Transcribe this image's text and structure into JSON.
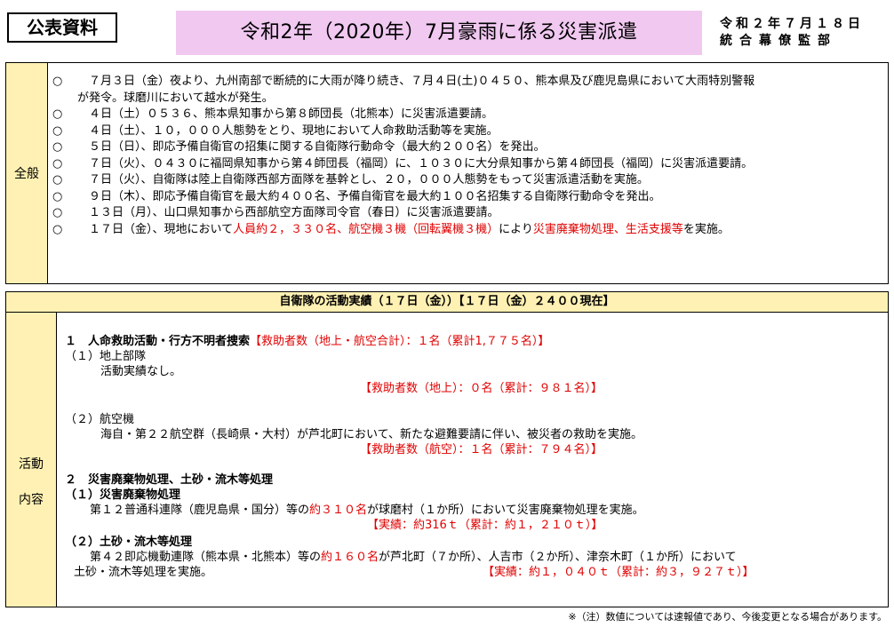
{
  "header": {
    "tag": "公表資料",
    "title": "令和2年（2020年）7月豪雨に係る災害派遣",
    "date": "令和２年７月１８日",
    "org": "統合幕僚監部"
  },
  "general": {
    "label": "全般",
    "bullet": "○",
    "items": [
      {
        "segs": [
          {
            "t": "　７月３日（金）夜より、九州南部で断続的に大雨が降り続き、７月４日(土)０４５０、熊本県及び鹿児島県において大雨特別警報",
            "red": false
          }
        ],
        "cont": "が発令。球磨川において越水が発生。"
      },
      {
        "segs": [
          {
            "t": "　４日（土）０５３６、熊本県知事から第８師団長（北熊本）に災害派遣要請。",
            "red": false
          }
        ]
      },
      {
        "segs": [
          {
            "t": "　４日（土）、１０，０００人態勢をとり、現地において人命救助活動等を実施。",
            "red": false
          }
        ]
      },
      {
        "segs": [
          {
            "t": "　５日（日）、即応予備自衛官の招集に関する自衛隊行動命令（最大約２００名）を発出。",
            "red": false
          }
        ]
      },
      {
        "segs": [
          {
            "t": "　７日（火）、０４３０に福岡県知事から第４師団長（福岡）に、１０３０に大分県知事から第４師団長（福岡）に災害派遣要請。",
            "red": false
          }
        ]
      },
      {
        "segs": [
          {
            "t": "　７日（火）、自衛隊は陸上自衛隊西部方面隊を基幹とし、２０，０００人態勢をもって災害派遣活動を実施。",
            "red": false
          }
        ]
      },
      {
        "segs": [
          {
            "t": "　９日（木）、即応予備自衛官を最大約４００名、予備自衛官を最大約１００名招集する自衛隊行動命令を発出。",
            "red": false
          }
        ]
      },
      {
        "segs": [
          {
            "t": "　１３日（月）、山口県知事から西部航空方面隊司令官（春日）に災害派遣要請。",
            "red": false
          }
        ]
      },
      {
        "segs": [
          {
            "t": "　１７日（金）、現地において",
            "red": false
          },
          {
            "t": "人員約２，３３０名、航空機３機（回転翼機３機）",
            "red": true
          },
          {
            "t": "により",
            "red": false
          },
          {
            "t": "災害廃棄物処理、生活支援等",
            "red": true
          },
          {
            "t": "を実施。",
            "red": false
          }
        ]
      }
    ]
  },
  "activity": {
    "header": "自衛隊の活動実績（１７日（金））【１７日（金）２４００現在】",
    "side_top": "活動",
    "side_bottom": "内容",
    "s1_title": "１　人命救助活動・行方不明者捜索",
    "s1_total": "【救助者数（地上・航空合計）：１名（累計1,７７５名）】",
    "s1_ground_label": "（１）地上部隊",
    "s1_ground_text": "活動実績なし。",
    "s1_ground_count": "【救助者数（地上）：０名（累計：９８１名）】",
    "s1_air_label": "（２）航空機",
    "s1_air_text": "海自・第２２航空群（長崎県・大村）が芦北町において、新たな避難要請に伴い、被災者の救助を実施。",
    "s1_air_count": "【救助者数（航空）：１名（累計：７９４名）】",
    "s2_title": "２　災害廃棄物処理、土砂・流木等処理",
    "s2_1_label": "（１）災害廃棄物処理",
    "s2_1_a": "第１２普通科連隊（鹿児島県・国分）等の",
    "s2_1_red": "約３１０名",
    "s2_1_b": "が球磨村（１か所）において災害廃棄物処理を実施。",
    "s2_1_result": "【実績：約316ｔ（累計：約１，２１０ｔ）】",
    "s2_2_label": "（２）土砂・流木等処理",
    "s2_2_a": "第４２即応機動連隊（熊本県・北熊本）等の",
    "s2_2_red": "約１６０名",
    "s2_2_b": "が芦北町（７か所）、人吉市（２か所）、津奈木町（１か所）において",
    "s2_2_cont": "土砂・流木等処理を実施。",
    "s2_2_result": "【実績：約１，０４０ｔ（累計：約３，９２７ｔ）】"
  },
  "footnote": "※（注）数値については速報値であり、今後変更となる場合があります。",
  "colors": {
    "accent_red": "#e00000",
    "title_bg": "#f0c8f0",
    "label_bg": "#fff1b3"
  }
}
